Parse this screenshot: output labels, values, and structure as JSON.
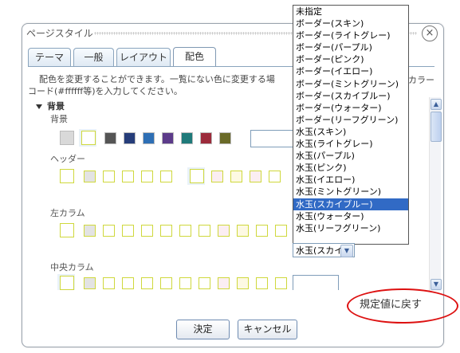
{
  "dialog": {
    "title": "ページスタイル",
    "close_icon": "×"
  },
  "tabs": [
    "テーマ",
    "一般",
    "レイアウト",
    "配色"
  ],
  "description": {
    "line1": "配色を変更することができます。一覧にない色に変更する場",
    "line1_tail": "カラー",
    "line2": "コード(#ffffff等)を入力してください。"
  },
  "group": {
    "label": "背景"
  },
  "sections": [
    {
      "label": "背景"
    },
    {
      "label": "ヘッダー"
    },
    {
      "label": "左カラム"
    },
    {
      "label": "中央カラム"
    }
  ],
  "background_colors": [
    "#d9d9d9",
    "#ffffff",
    "#555555",
    "#263d7a",
    "#2e6fb5",
    "#5c3b8a",
    "#1f7a7a",
    "#9c2b3b",
    "#6a6a28"
  ],
  "dropdown": {
    "items": [
      "未指定",
      "ボーダー(スキン)",
      "ボーダー(ライトグレー)",
      "ボーダー(パープル)",
      "ボーダー(ピンク)",
      "ボーダー(イエロー)",
      "ボーダー(ミントグリーン)",
      "ボーダー(スカイブルー)",
      "ボーダー(ウォーター)",
      "ボーダー(リーフグリーン)",
      "水玉(スキン)",
      "水玉(ライトグレー)",
      "水玉(パープル)",
      "水玉(ピンク)",
      "水玉(イエロー)",
      "水玉(ミントグリーン)",
      "水玉(スカイブルー)",
      "水玉(ウォーター)",
      "水玉(リーフグリーン)"
    ],
    "selected_index": 16,
    "selected_text": "水玉(スカイ"
  },
  "reset_label": "規定値に戻す",
  "buttons": {
    "ok": "決定",
    "cancel": "キャンセル"
  },
  "icons": {
    "scroll_up": "▲",
    "scroll_down": "▼",
    "select_arrow": "▼"
  },
  "colors": {
    "accent_border": "#cfd83c",
    "selection": "#316ac5",
    "annotation": "#dd1111"
  }
}
